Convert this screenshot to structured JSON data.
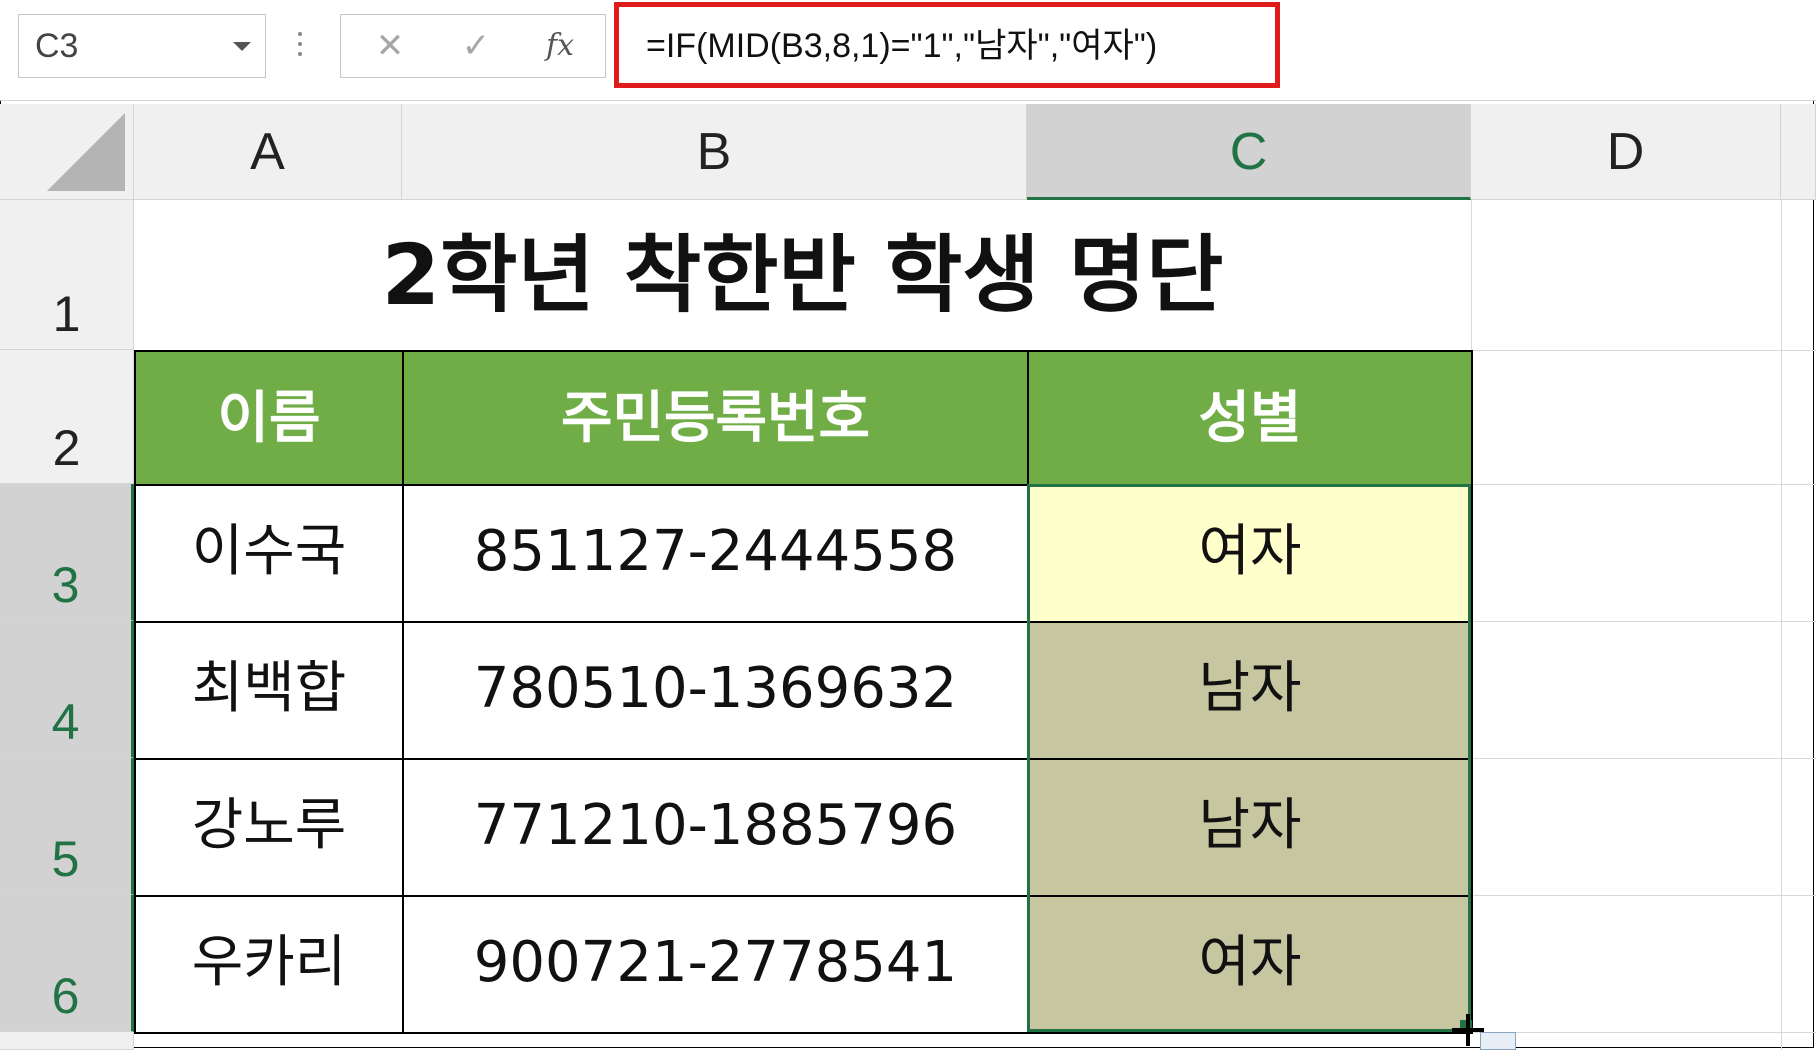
{
  "name_box": {
    "value": "C3"
  },
  "formula_bar": {
    "cancel_glyph": "✕",
    "enter_glyph": "✓",
    "fx_label": "fx",
    "formula": "=IF(MID(B3,8,1)=\"1\",\"남자\",\"여자\")"
  },
  "columns": [
    "A",
    "B",
    "C",
    "D"
  ],
  "active_column": "C",
  "rows": [
    "1",
    "2",
    "3",
    "4",
    "5",
    "6"
  ],
  "active_row": "3",
  "sheet": {
    "title": "2학년 착한반 학생 명단",
    "headers": [
      "이름",
      "주민등록번호",
      "성별"
    ],
    "records": [
      {
        "name": "이수국",
        "id": "851127-2444558",
        "gender": "여자"
      },
      {
        "name": "최백합",
        "id": "780510-1369632",
        "gender": "남자"
      },
      {
        "name": "강노루",
        "id": "771210-1885796",
        "gender": "남자"
      },
      {
        "name": "우카리",
        "id": "900721-2778541",
        "gender": "여자"
      }
    ]
  },
  "colors": {
    "header_fill": "#70ad47",
    "selection": "#217346",
    "highlight_box": "#e01b1b",
    "active_cell_fill": "#ffffcc",
    "selected_range_fill": "#c6c6a0"
  }
}
